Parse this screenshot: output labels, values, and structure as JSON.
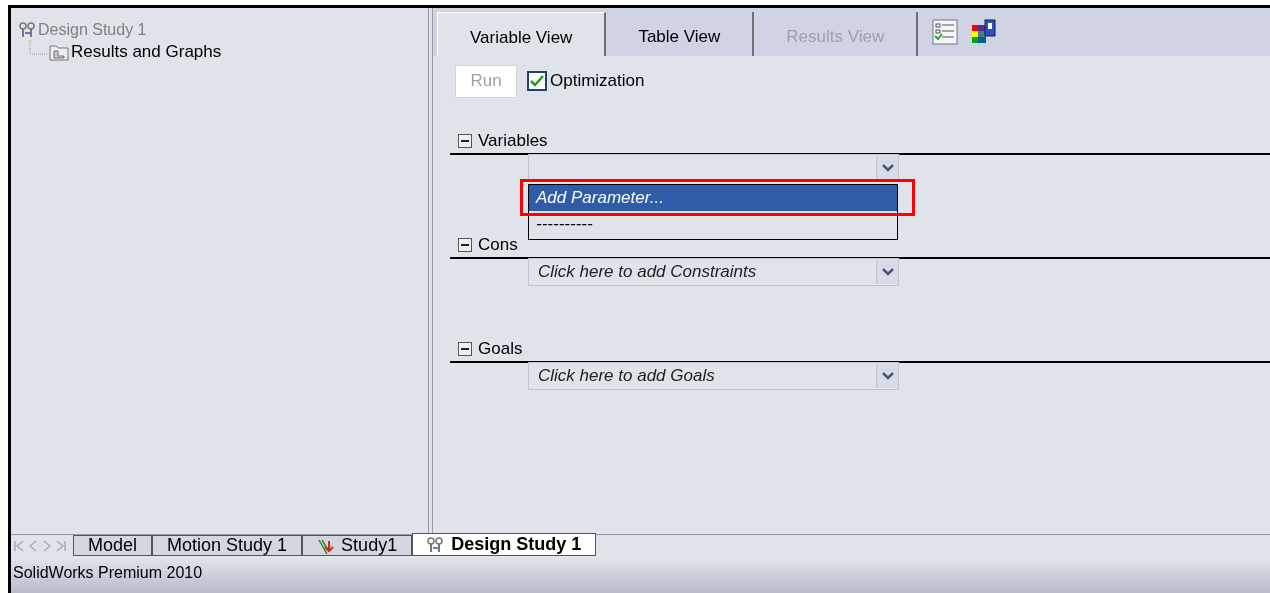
{
  "tree": {
    "label": "Design Study 1",
    "children": [
      {
        "label": "Results and Graphs"
      }
    ]
  },
  "view_tabs": [
    {
      "label": "Variable View",
      "selected": true,
      "disabled": false
    },
    {
      "label": "Table View",
      "selected": false,
      "disabled": false
    },
    {
      "label": "Results View",
      "selected": false,
      "disabled": true
    }
  ],
  "toolbar": {
    "run_button": {
      "label": "Run",
      "disabled": true
    },
    "optimization": {
      "label": "Optimization",
      "checked": true
    }
  },
  "sections": [
    {
      "title": "Variables",
      "expanded": true,
      "dropdown_menu": {
        "highlight_box": true,
        "items": [
          {
            "label": "Add Parameter...",
            "selected": true
          },
          {
            "label": "----------",
            "selected": false
          }
        ]
      }
    },
    {
      "title": "Cons",
      "expanded": true,
      "placeholder": "Click here to add Constraints"
    },
    {
      "title": "Goals",
      "expanded": true,
      "placeholder": "Click here to add Goals"
    }
  ],
  "bottom_tabs": [
    {
      "label": "Model",
      "selected": false,
      "kind": "plain"
    },
    {
      "label": "Motion Study 1",
      "selected": false,
      "kind": "plain"
    },
    {
      "label": "Study1",
      "selected": false,
      "kind": "simulation"
    },
    {
      "label": "Design Study 1",
      "selected": true,
      "kind": "design"
    }
  ],
  "status_bar": {
    "text": "SolidWorks Premium 2010"
  }
}
